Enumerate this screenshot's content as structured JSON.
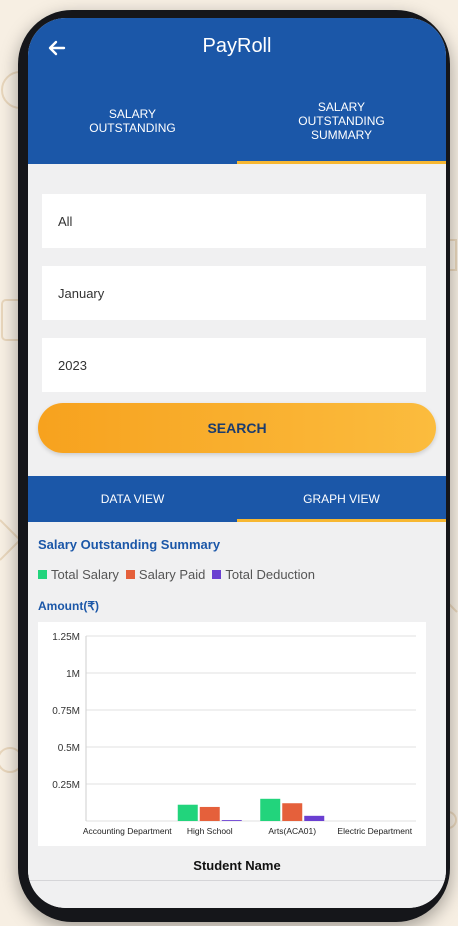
{
  "app": {
    "title": "PayRoll"
  },
  "top_tabs": [
    {
      "label": "SALARY OUTSTANDING",
      "active": false
    },
    {
      "label": "SALARY OUTSTANDING SUMMARY",
      "active": true
    }
  ],
  "filters": {
    "department": "All",
    "month": "January",
    "year": "2023"
  },
  "search_button": "SEARCH",
  "view_tabs": [
    {
      "label": "DATA VIEW",
      "active": false
    },
    {
      "label": "GRAPH VIEW",
      "active": true
    }
  ],
  "summary": {
    "title": "Salary Outstanding Summary",
    "axis_label": "Amount(₹)",
    "x_axis_title": "Student Name"
  },
  "colors": {
    "accent": "#1b57a8",
    "highlight": "#f7b731",
    "total_salary": "#22d47c",
    "salary_paid": "#e5603b",
    "total_deduction": "#6a3fd1"
  },
  "icons": {
    "back": "back-arrow-icon"
  },
  "chart_data": {
    "type": "bar",
    "categories": [
      "Accounting Department",
      "High School",
      "Arts(ACA01)",
      "Electric Department"
    ],
    "series": [
      {
        "name": "Total Salary",
        "values": [
          0,
          110000,
          150000,
          0
        ]
      },
      {
        "name": "Salary Paid",
        "values": [
          0,
          95000,
          120000,
          0
        ]
      },
      {
        "name": "Total Deduction",
        "values": [
          0,
          6000,
          35000,
          0
        ]
      }
    ],
    "ylabel": "Amount(₹)",
    "xlabel": "Student Name",
    "ylim": [
      0,
      1250000
    ],
    "yticks": [
      0,
      250000,
      500000,
      750000,
      1000000,
      1250000
    ],
    "ytick_labels": [
      "",
      "0.25M",
      "0.5M",
      "0.75M",
      "1M",
      "1.25M"
    ],
    "grid": true,
    "legend_position": "top-left"
  }
}
